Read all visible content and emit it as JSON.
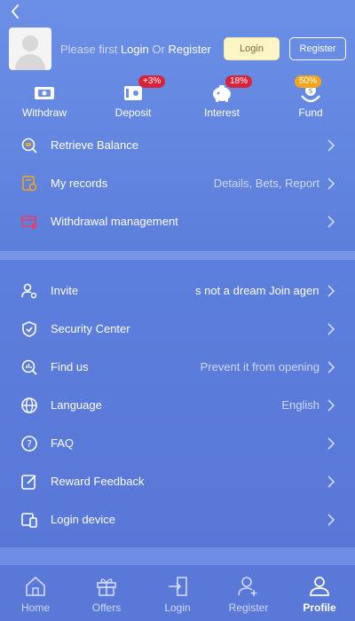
{
  "header": {
    "prompt_prefix": "Please first",
    "prompt_login": "Login",
    "prompt_or": "Or",
    "prompt_register": "Register",
    "login_button": "Login",
    "register_button": "Register"
  },
  "quick_actions": [
    {
      "label": "Withdraw",
      "icon": "withdraw-icon",
      "badge": ""
    },
    {
      "label": "Deposit",
      "icon": "deposit-icon",
      "badge": "+3%"
    },
    {
      "label": "Interest",
      "icon": "interest-icon",
      "badge": "18%"
    },
    {
      "label": "Fund",
      "icon": "fund-icon",
      "badge": "50%"
    }
  ],
  "menu_top": [
    {
      "label": "Retrieve Balance",
      "value": "",
      "icon": "balance-search-icon"
    },
    {
      "label": "My records",
      "value": "Details, Bets, Report",
      "icon": "records-icon"
    },
    {
      "label": "Withdrawal management",
      "value": "",
      "icon": "card-icon"
    }
  ],
  "menu_bottom": [
    {
      "label": "Invite",
      "value": "s not a dream  Join agent",
      "icon": "invite-icon"
    },
    {
      "label": "Security Center",
      "value": "",
      "icon": "shield-icon"
    },
    {
      "label": "Find us",
      "value": "Prevent it from opening",
      "icon": "find-icon"
    },
    {
      "label": "Language",
      "value": "English",
      "icon": "globe-icon"
    },
    {
      "label": "FAQ",
      "value": "",
      "icon": "question-icon"
    },
    {
      "label": "Reward Feedback",
      "value": "",
      "icon": "edit-icon"
    },
    {
      "label": "Login device",
      "value": "",
      "icon": "device-icon"
    }
  ],
  "tabs": [
    {
      "label": "Home",
      "icon": "home-icon"
    },
    {
      "label": "Offers",
      "icon": "gift-icon"
    },
    {
      "label": "Login",
      "icon": "login-icon"
    },
    {
      "label": "Register",
      "icon": "add-user-icon"
    },
    {
      "label": "Profile",
      "icon": "profile-icon"
    }
  ],
  "colors": {
    "background": "#5d7fdc",
    "login_button_bg": "#fdf5c6",
    "badge_red": "#d9233a",
    "badge_orange": "#f4a51c"
  }
}
